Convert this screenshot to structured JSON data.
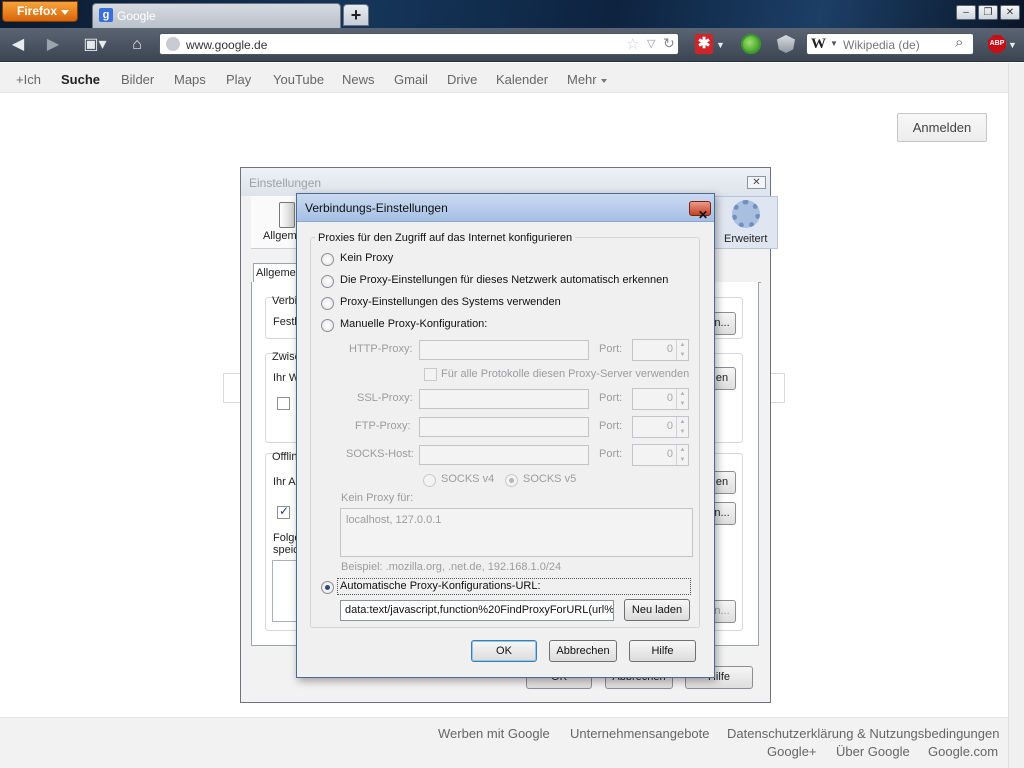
{
  "browser": {
    "app_button": "Firefox",
    "tab_title": "Google",
    "url": "www.google.de",
    "search_engine_placeholder": "Wikipedia (de)"
  },
  "gbar": {
    "items": [
      "+Ich",
      "Suche",
      "Bilder",
      "Maps",
      "Play",
      "YouTube",
      "News",
      "Gmail",
      "Drive",
      "Kalender",
      "Mehr"
    ]
  },
  "google": {
    "signin_label": "Anmelden"
  },
  "footer": {
    "row1": [
      "Werben mit Google",
      "Unternehmensangebote",
      "Datenschutzerklärung & Nutzungsbedingungen"
    ],
    "row2": [
      "Google+",
      "Über Google",
      "Google.com"
    ]
  },
  "settings": {
    "title": "Einstellungen",
    "panes": [
      "Allgeme",
      "Erweitert"
    ],
    "subtab": "Allgemein",
    "fragments": [
      "Verbin",
      "Festl",
      "Zwisc",
      "Ihr W",
      "Offlin",
      "Ihr A",
      "Folge",
      "speic"
    ],
    "button_fragments": [
      "n...",
      "en",
      "en",
      "n...",
      "n..."
    ],
    "bottom_buttons": [
      "OK",
      "Abbrechen",
      "Hilfe"
    ]
  },
  "conn": {
    "title": "Verbindungs-Einstellungen",
    "legend": "Proxies für den Zugriff auf das Internet konfigurieren",
    "options": [
      "Kein Proxy",
      "Die Proxy-Einstellungen für dieses Netzwerk automatisch erkennen",
      "Proxy-Einstellungen des Systems verwenden",
      "Manuelle Proxy-Konfiguration:"
    ],
    "http_label": "HTTP-Proxy:",
    "ssl_label": "SSL-Proxy:",
    "ftp_label": "FTP-Proxy:",
    "socks_label": "SOCKS-Host:",
    "port_label": "Port:",
    "port_value": "0",
    "all_protocols": "Für alle Protokolle diesen Proxy-Server verwenden",
    "socks_v4": "SOCKS v4",
    "socks_v5": "SOCKS v5",
    "noproxy_label": "Kein Proxy für:",
    "noproxy_value": "localhost, 127.0.0.1",
    "noproxy_example": "Beispiel: .mozilla.org, .net.de, 192.168.1.0/24",
    "pac_label": "Automatische Proxy-Konfigurations-URL:",
    "pac_value": "data:text/javascript,function%20FindProxyForURL(url%",
    "reload": "Neu laden",
    "ok": "OK",
    "cancel": "Abbrechen",
    "help": "Hilfe",
    "selected_option": "Automatische Proxy-Konfigurations-URL:"
  }
}
